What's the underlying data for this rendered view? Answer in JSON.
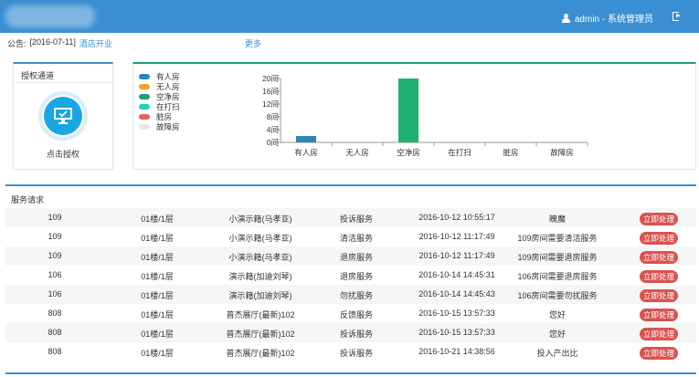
{
  "header": {
    "user_label": "admin - 系统管理员"
  },
  "notice": {
    "prefix": "公告:",
    "date": "[2016-07-11]",
    "link": "酒店开业",
    "more": "更多"
  },
  "auth": {
    "title": "授权通道",
    "action_label": "点击授权"
  },
  "legend": [
    {
      "label": "有人房",
      "color": "#2e86b8"
    },
    {
      "label": "无人房",
      "color": "#f0a030"
    },
    {
      "label": "空净房",
      "color": "#20a070"
    },
    {
      "label": "在打扫",
      "color": "#20d0c0"
    },
    {
      "label": "脏房",
      "color": "#e8645a"
    },
    {
      "label": "故障房",
      "color": "#e6e6e6"
    }
  ],
  "chart_data": {
    "type": "bar",
    "categories": [
      "有人房",
      "无人房",
      "空净房",
      "在打扫",
      "脏房",
      "故障房"
    ],
    "values": [
      2,
      0,
      20,
      0,
      0,
      0
    ],
    "colors": [
      "#2e86b8",
      "#f0a030",
      "#20b070",
      "#20d0c0",
      "#e8645a",
      "#e6e6e6"
    ],
    "ylim": [
      0,
      20
    ],
    "yticks": [
      "0间",
      "4间",
      "8间",
      "12间",
      "16间",
      "20间"
    ],
    "ytick_values": [
      0,
      4,
      8,
      12,
      16,
      20
    ],
    "grid": false
  },
  "service": {
    "title": "服务请求",
    "rows": [
      {
        "room": "109",
        "floor": "01楼/1层",
        "guest": "小演示籍(马孝亚)",
        "type": "投诉服务",
        "time": "2016-10-12 10:55:17",
        "content": "魄魔",
        "action": "立即处理"
      },
      {
        "room": "109",
        "floor": "01楼/1层",
        "guest": "小演示籍(马孝亚)",
        "type": "清洁服务",
        "time": "2016-10-12 11:17:49",
        "content": "109房间需要清洁服务",
        "action": "立即处理"
      },
      {
        "room": "109",
        "floor": "01楼/1层",
        "guest": "小演示籍(马孝亚)",
        "type": "退房服务",
        "time": "2016-10-12 11:17:49",
        "content": "109房间需要退房服务",
        "action": "立即处理"
      },
      {
        "room": "106",
        "floor": "01楼/1层",
        "guest": "演示籍(加迪刘琴)",
        "type": "退房服务",
        "time": "2016-10-14 14:45:31",
        "content": "106房间需要退房服务",
        "action": "立即处理"
      },
      {
        "room": "106",
        "floor": "01楼/1层",
        "guest": "演示籍(加迪刘琴)",
        "type": "勿扰服务",
        "time": "2016-10-14 14:45:43",
        "content": "106房间需要勿扰服务",
        "action": "立即处理"
      },
      {
        "room": "808",
        "floor": "01楼/1层",
        "guest": "普杰展厅(最新)102",
        "type": "反馈服务",
        "time": "2016-10-15 13:57:33",
        "content": "您好",
        "action": "立即处理"
      },
      {
        "room": "808",
        "floor": "01楼/1层",
        "guest": "普杰展厅(最新)102",
        "type": "投诉服务",
        "time": "2016-10-15 13:57:33",
        "content": "您好",
        "action": "立即处理"
      },
      {
        "room": "808",
        "floor": "01楼/1层",
        "guest": "普杰展厅(最新)102",
        "type": "投诉服务",
        "time": "2016-10-21 14:38:56",
        "content": "投入产出比",
        "action": "立即处理"
      }
    ]
  }
}
